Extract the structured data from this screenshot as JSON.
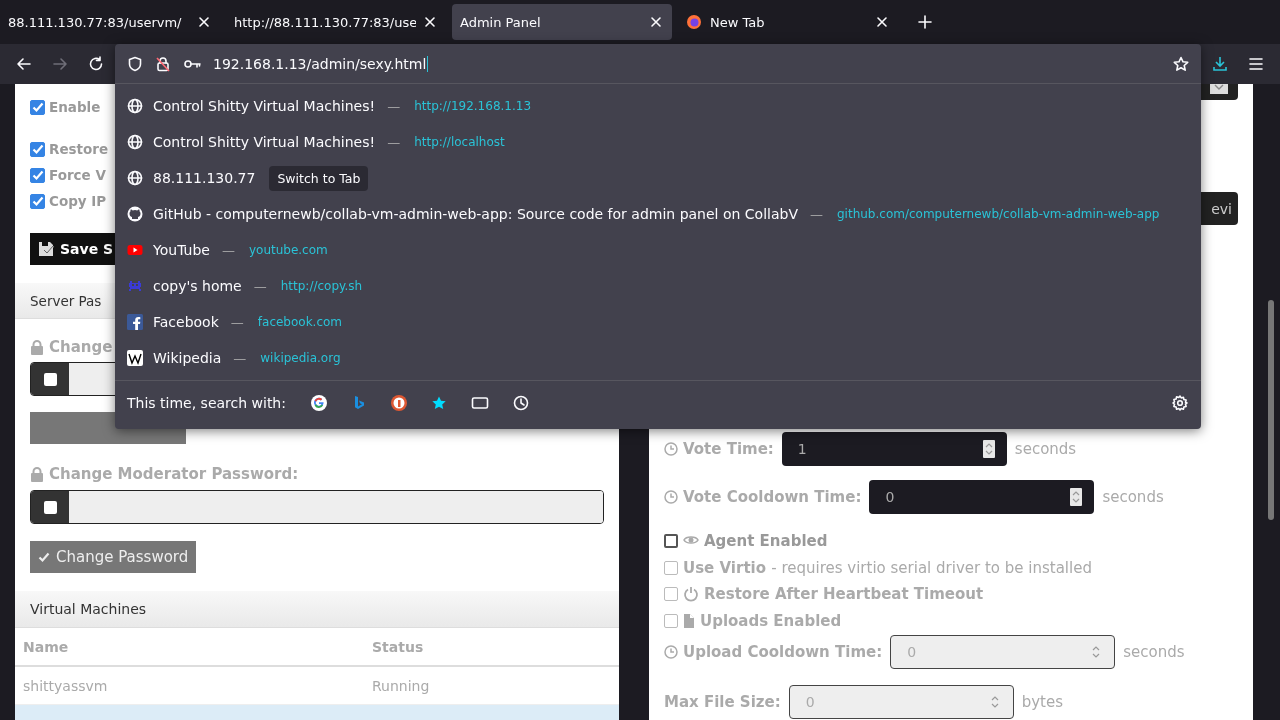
{
  "tabs": [
    {
      "label": "88.111.130.77:83/uservm/",
      "selected": false,
      "has_icon": false
    },
    {
      "label": "http://88.111.130.77:83/use",
      "selected": false,
      "has_icon": false
    },
    {
      "label": "Admin Panel",
      "selected": true,
      "has_icon": false
    },
    {
      "label": "New Tab",
      "selected": false,
      "has_icon": true
    }
  ],
  "nav": {
    "back": {
      "disabled": false
    },
    "forward": {
      "disabled": true
    }
  },
  "url_popup": {
    "value": "192.168.1.13/admin/sexy.html",
    "suggestions": [
      {
        "kind": "page",
        "title": "Control Shitty Virtual Machines!",
        "separator": "—",
        "url": "http://192.168.1.13"
      },
      {
        "kind": "page",
        "title": "Control Shitty Virtual Machines!",
        "separator": "—",
        "url": "http://localhost"
      },
      {
        "kind": "page",
        "title": "88.111.130.77",
        "action": "Switch to Tab"
      },
      {
        "kind": "github",
        "title": "GitHub - computernewb/collab-vm-admin-web-app: Source code for admin panel on CollabV",
        "separator": "—",
        "url": "github.com/computernewb/collab-vm-admin-web-app"
      },
      {
        "kind": "video",
        "title": "YouTube",
        "separator": "—",
        "url": "youtube.com"
      },
      {
        "kind": "invader",
        "title": "copy's home",
        "separator": "—",
        "url": "http://copy.sh"
      },
      {
        "kind": "facebook",
        "title": "Facebook",
        "separator": "—",
        "url": "facebook.com"
      },
      {
        "kind": "wiki",
        "title": "Wikipedia",
        "separator": "—",
        "url": "wikipedia.org"
      }
    ],
    "search_label": "This time, search with:"
  },
  "left": {
    "options": [
      {
        "label": "Enable",
        "checked": true
      },
      {
        "label": "Restore",
        "checked": true
      },
      {
        "label": "Force V",
        "checked": true
      },
      {
        "label": "Copy IP",
        "checked": true
      }
    ],
    "save_button": "Save S",
    "server_password": {
      "header": "Server Pas",
      "label": "Change",
      "checked": false
    },
    "moderator_password": {
      "label": "Change Moderator Password:",
      "checked": false,
      "button": "Change Password"
    },
    "virtual_machines": {
      "header": "Virtual Machines",
      "columns": [
        "Name",
        "Status"
      ],
      "rows": [
        {
          "cells": [
            "shittyassvm",
            "Running"
          ],
          "selected": false
        },
        {
          "selected": true
        }
      ]
    }
  },
  "right": {
    "device_button": "evi",
    "fields": [
      {
        "kind": "timed-number",
        "label": "Vote Time:",
        "value": "1",
        "unit": "seconds",
        "disabled": false
      },
      {
        "kind": "timed-number",
        "label": "Vote Cooldown Time:",
        "value": "0",
        "unit": "seconds",
        "disabled": false
      },
      {
        "kind": "agent-check",
        "label": "Agent Enabled",
        "checked": false,
        "disabled": false
      },
      {
        "kind": "check",
        "label": "Use Virtio",
        "note": "- requires virtio serial driver to be installed",
        "checked": false,
        "disabled": true
      },
      {
        "kind": "power-check",
        "label": "Restore After Heartbeat Timeout",
        "checked": false,
        "disabled": true
      },
      {
        "kind": "file-check",
        "label": "Uploads Enabled",
        "checked": false,
        "disabled": true
      },
      {
        "kind": "timed-number",
        "label": "Upload Cooldown Time:",
        "value": "0",
        "unit": "seconds",
        "disabled": true
      },
      {
        "kind": "number",
        "label": "Max File Size:",
        "value": "0",
        "unit": "bytes",
        "disabled": true
      }
    ]
  }
}
